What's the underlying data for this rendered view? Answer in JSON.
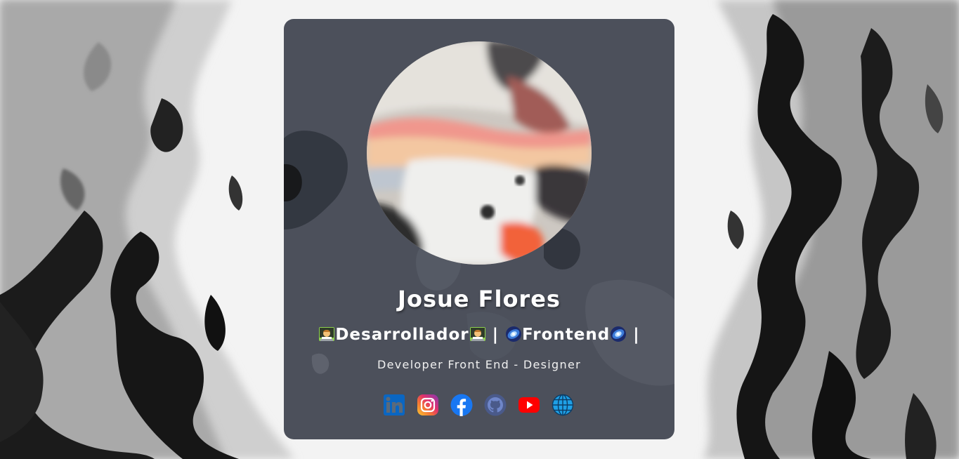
{
  "profile": {
    "name": "Josue Flores",
    "role_part1": "Desarrollador",
    "role_sep1": " | ",
    "role_part2": "Frontend",
    "role_sep2": " |",
    "tagline": "Developer Front End - Designer",
    "role_emojis": [
      "technologist-icon",
      "galaxy-icon"
    ]
  },
  "socials": [
    {
      "name": "linkedin-icon",
      "color": "#0a66c2"
    },
    {
      "name": "instagram-icon",
      "color": "#e1306c"
    },
    {
      "name": "facebook-icon",
      "color": "#1877f2"
    },
    {
      "name": "github-icon",
      "color": "#4a5a8a"
    },
    {
      "name": "youtube-icon",
      "color": "#ff0000"
    },
    {
      "name": "website-globe-icon",
      "color": "#1ea0e6"
    }
  ],
  "theme": {
    "card_background": "#3a3e4a",
    "text_color": "#ffffff",
    "page_background": "#f4f4f4"
  }
}
